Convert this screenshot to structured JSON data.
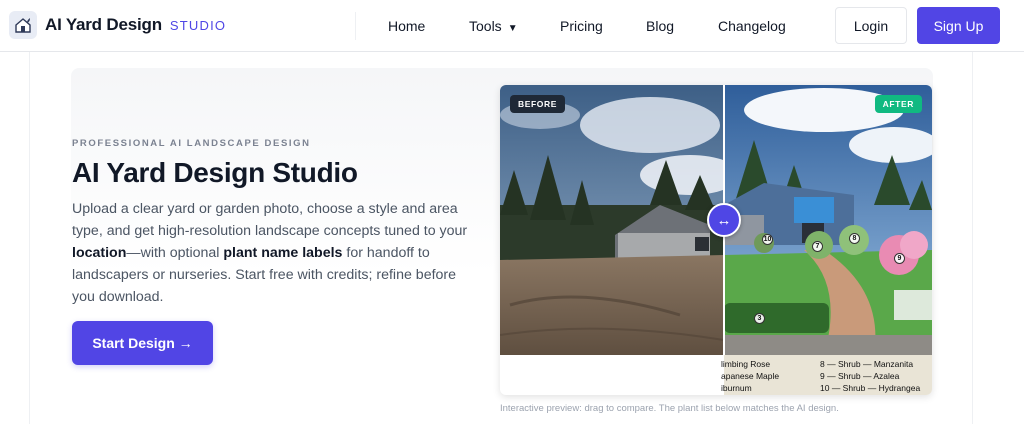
{
  "brand": {
    "name": "AI Yard Design",
    "sub": "STUDIO"
  },
  "nav": {
    "home": "Home",
    "tools": "Tools",
    "tools_caret": "▼",
    "pricing": "Pricing",
    "blog": "Blog",
    "changelog": "Changelog"
  },
  "auth": {
    "login": "Login",
    "signup": "Sign Up"
  },
  "hero": {
    "eyebrow": "PROFESSIONAL AI LANDSCAPE DESIGN",
    "title": "AI Yard Design Studio",
    "desc_1": "Upload a clear yard or garden photo, choose a style and area type, and get high-resolution landscape concepts tuned to your ",
    "desc_b1": "location",
    "desc_2": "—with optional ",
    "desc_b2": "plant name labels",
    "desc_3": " for handoff to landscapers or nurseries. Start free with credits; refine before you download.",
    "cta": "Start Design →"
  },
  "preview": {
    "before_label": "BEFORE",
    "after_label": "AFTER",
    "handle_glyph": "↔",
    "markers": [
      "10",
      "7",
      "8",
      "9",
      "3"
    ],
    "legend_left": [
      "limbing Rose",
      "apanese Maple",
      "iburnum"
    ],
    "legend_right": [
      "8 — Shrub — Manzanita",
      "9 — Shrub — Azalea",
      "10 — Shrub — Hydrangea"
    ],
    "caption": "Interactive preview: drag to compare. The plant list below matches the AI design."
  },
  "colors": {
    "accent": "#5145e5",
    "after_badge": "#10b981",
    "before_badge": "#1f2937"
  },
  "icons": {
    "logo": "house-plant-icon",
    "handle": "arrows-horizontal-icon"
  }
}
